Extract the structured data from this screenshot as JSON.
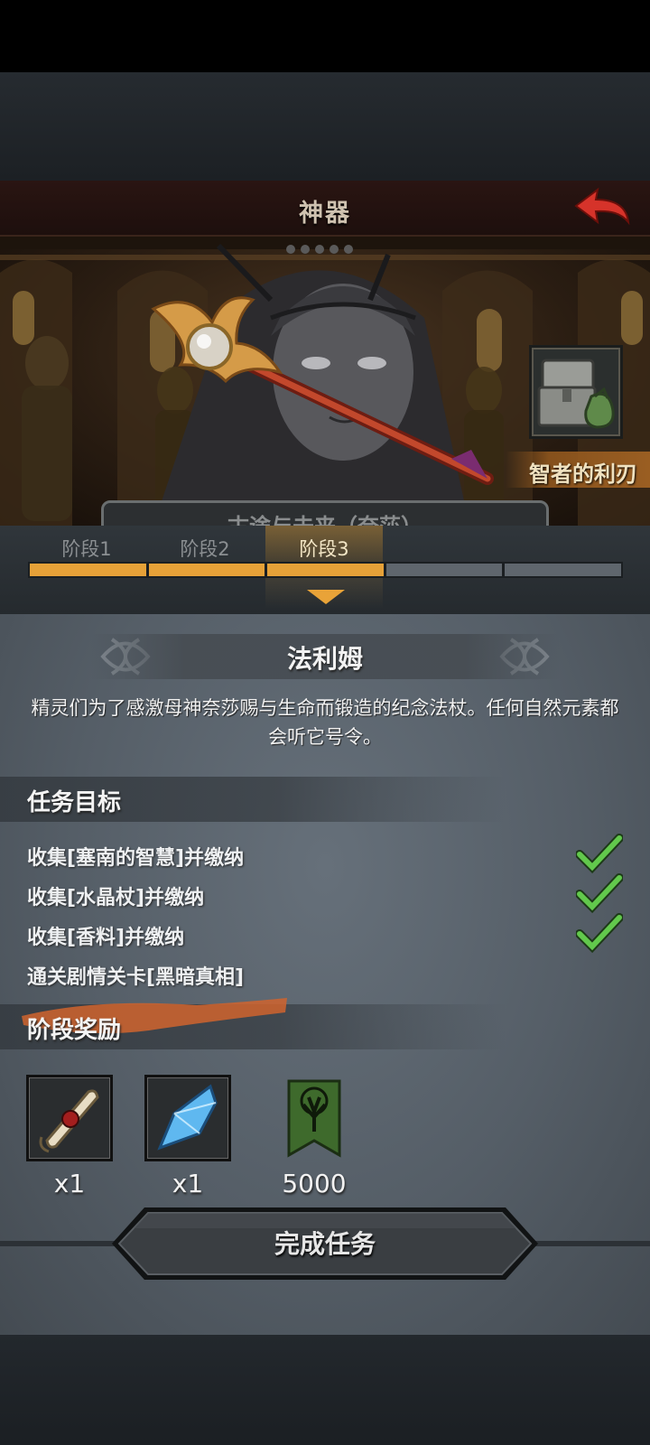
{
  "header": {
    "title": "神器",
    "back_icon": "red-back-arrow-icon"
  },
  "scene": {
    "weapon_tag": "智者的利刃",
    "story_plate": "古途与未来（奈莎）",
    "chest_icon": "treasure-chest-icon"
  },
  "stages": {
    "tabs": [
      {
        "label": "阶段1"
      },
      {
        "label": "阶段2"
      },
      {
        "label": "阶段3"
      }
    ],
    "active_index": 2,
    "total_segments": 5,
    "completed_segments": 3,
    "colors": {
      "filled": "#e6a138",
      "empty": "#5f666d"
    }
  },
  "item": {
    "name": "法利姆",
    "description": "精灵们为了感激母神奈莎赐与生命而锻造的纪念法杖。任何自然元素都会听它号令。"
  },
  "tasks": {
    "title": "任务目标",
    "items": [
      {
        "text": "收集[塞南的智慧]并缴纳",
        "done": true
      },
      {
        "text": "收集[水晶杖]并缴纳",
        "done": true
      },
      {
        "text": "收集[香料]并缴纳",
        "done": true
      },
      {
        "text": "通关剧情关卡[黑暗真相]",
        "done": false
      }
    ]
  },
  "rewards": {
    "title": "阶段奖励",
    "items": [
      {
        "icon": "scroll-icon",
        "count": "x1"
      },
      {
        "icon": "blue-crystal-icon",
        "count": "x1"
      },
      {
        "icon": "tree-banner-icon",
        "count": "5000"
      }
    ]
  },
  "actions": {
    "complete": "完成任务"
  },
  "colors": {
    "accent": "#e6a138",
    "check": "#5ec24a",
    "header_bg": "#231210"
  }
}
